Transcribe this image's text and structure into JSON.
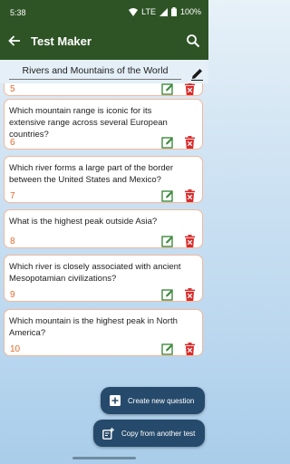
{
  "status": {
    "time": "5:38",
    "network": "LTE",
    "battery": "100%"
  },
  "app_bar": {
    "title": "Test Maker"
  },
  "subject": {
    "title": "Rivers and Mountains of the World"
  },
  "questions": [
    {
      "number": "5",
      "text": ""
    },
    {
      "number": "6",
      "text": "Which mountain range is iconic for its extensive range across several European countries?"
    },
    {
      "number": "7",
      "text": "Which river forms a large part of the border between the United States and Mexico?"
    },
    {
      "number": "8",
      "text": "What is the highest peak outside Asia?"
    },
    {
      "number": "9",
      "text": "Which river is closely associated with ancient Mesopotamian civilizations?"
    },
    {
      "number": "10",
      "text": "Which mountain is the highest peak in North America?"
    }
  ],
  "actions": {
    "create_label": "Create new question",
    "copy_label": "Copy from another test"
  },
  "colors": {
    "app_bar": "#2e5426",
    "number": "#e8692a",
    "edit_icon": "#3f8a3f",
    "delete_icon": "#d92b2b",
    "fab": "#264a6b"
  },
  "icons": {
    "back": "arrow-left-icon",
    "search": "search-icon",
    "edit": "edit-square-icon",
    "delete": "trash-icon",
    "create": "add-box-icon",
    "copy": "copy-add-icon"
  }
}
